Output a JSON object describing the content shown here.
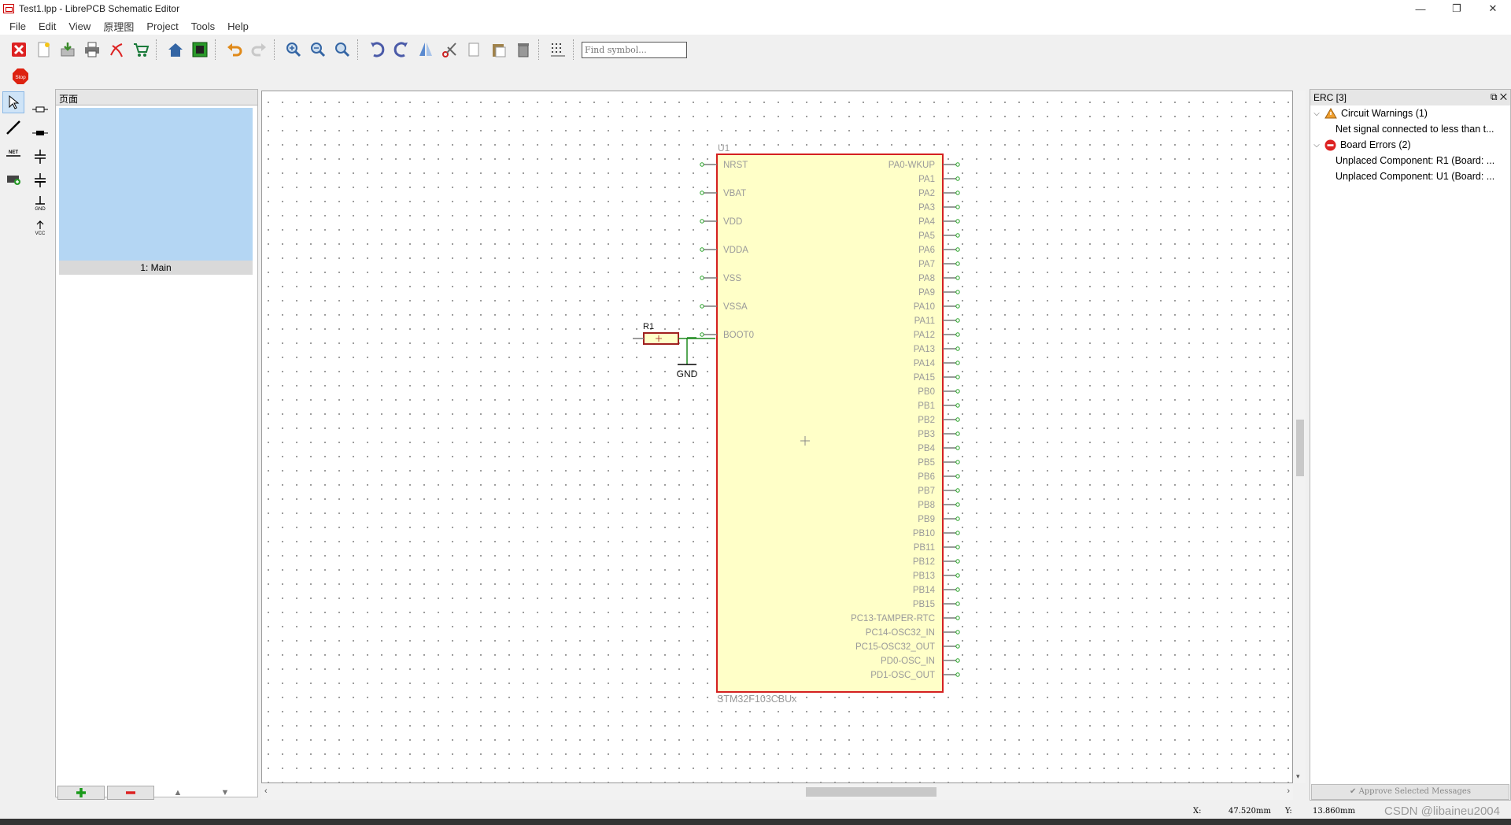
{
  "window": {
    "title": "Test1.lpp - LibrePCB Schematic Editor",
    "min": "—",
    "max": "❐",
    "close": "✕"
  },
  "menu": [
    "File",
    "Edit",
    "View",
    "原理图",
    "Project",
    "Tools",
    "Help"
  ],
  "toolbar": {
    "find_placeholder": "Find symbol..."
  },
  "toolbar2": {
    "stop_label": "Stop"
  },
  "pages_panel": {
    "title": "页面",
    "items": [
      {
        "label": "1: Main"
      }
    ]
  },
  "components": {
    "gnd_label": "GND",
    "vcc_label": "VCC",
    "net_label": "NET"
  },
  "schematic": {
    "u1": {
      "name": "U1",
      "value": "STM32F103CBUx",
      "left_pins": [
        "NRST",
        "VBAT",
        "VDD",
        "VDDA",
        "VSS",
        "VSSA",
        "BOOT0"
      ],
      "right_pins": [
        "PA0-WKUP",
        "PA1",
        "PA2",
        "PA3",
        "PA4",
        "PA5",
        "PA6",
        "PA7",
        "PA8",
        "PA9",
        "PA10",
        "PA11",
        "PA12",
        "PA13",
        "PA14",
        "PA15",
        "PB0",
        "PB1",
        "PB2",
        "PB3",
        "PB4",
        "PB5",
        "PB6",
        "PB7",
        "PB8",
        "PB9",
        "PB10",
        "PB11",
        "PB12",
        "PB13",
        "PB14",
        "PB15",
        "PC13-TAMPER-RTC",
        "PC14-OSC32_IN",
        "PC15-OSC32_OUT",
        "PD0-OSC_IN",
        "PD1-OSC_OUT"
      ]
    },
    "r1": {
      "name": "R1"
    },
    "gnd": {
      "label": "GND"
    },
    "colors": {
      "outline": "#d42020",
      "body": "#ffffc8",
      "pin": "#7a7a7a",
      "pin_end": "#23a023",
      "wire": "#1f8a1f",
      "text": "#9a9a9a"
    }
  },
  "erc": {
    "title": "ERC [3]",
    "groups": [
      {
        "label": "Circuit Warnings (1)",
        "icon": "warning-icon",
        "items": [
          "Net signal connected to less than t..."
        ]
      },
      {
        "label": "Board Errors (2)",
        "icon": "error-icon",
        "items": [
          "Unplaced Component: R1 (Board: ...",
          "Unplaced Component: U1 (Board: ..."
        ]
      }
    ],
    "approve_label": "Approve Selected Messages"
  },
  "status": {
    "x_label": "X:",
    "x_value": "47.520mm",
    "y_label": "Y:",
    "y_value": "13.860mm"
  },
  "watermark": "CSDN @libaineu2004"
}
